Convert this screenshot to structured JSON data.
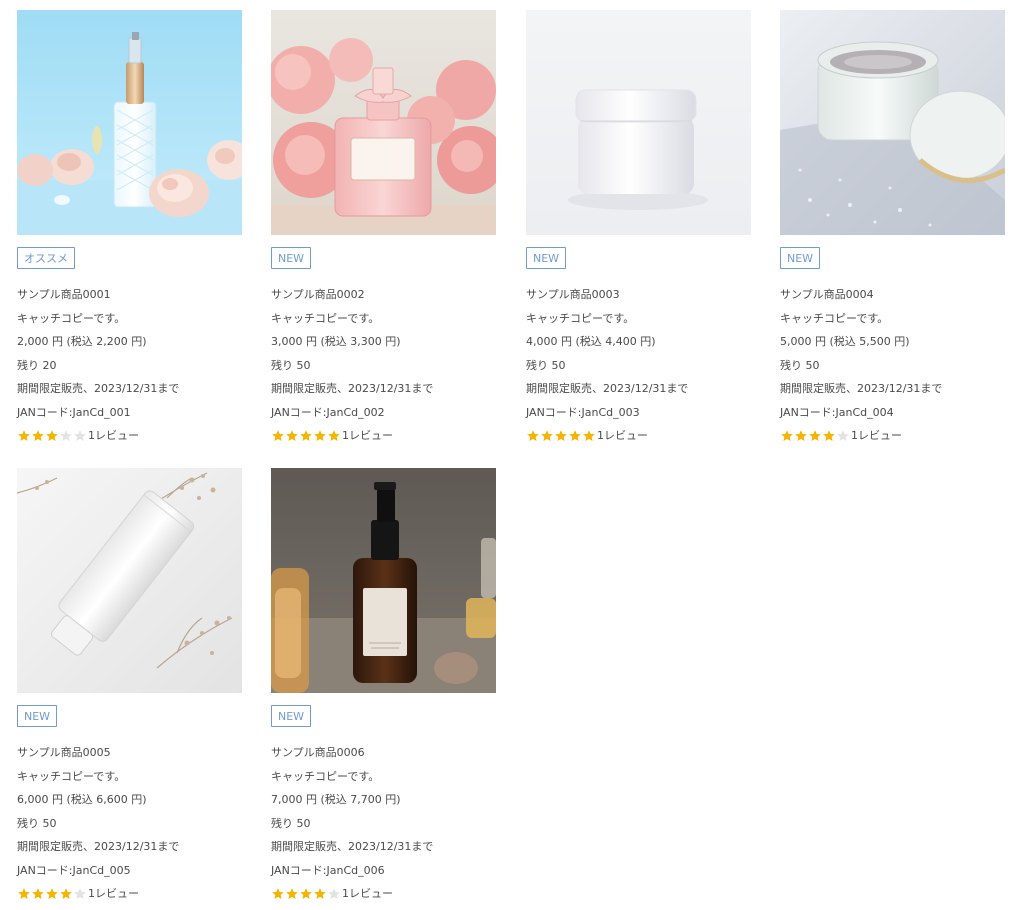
{
  "products": [
    {
      "badge": "オススメ",
      "name": "サンプル商品0001",
      "catch": "キャッチコピーです。",
      "price": "2,000 円 (税込 2,200 円)",
      "stock": "残り 20",
      "limited": "期間限定販売、2023/12/31まで",
      "jan": "JANコード:JanCd_001",
      "rating": 3,
      "reviews": "1レビュー",
      "image": "perfume-spray-bottle-with-roses-on-blue"
    },
    {
      "badge": "NEW",
      "name": "サンプル商品0002",
      "catch": "キャッチコピーです。",
      "price": "3,000 円 (税込 3,300 円)",
      "stock": "残り 50",
      "limited": "期間限定販売、2023/12/31まで",
      "jan": "JANコード:JanCd_002",
      "rating": 5,
      "reviews": "1レビュー",
      "image": "pink-perfume-bottle-with-pink-roses"
    },
    {
      "badge": "NEW",
      "name": "サンプル商品0003",
      "catch": "キャッチコピーです。",
      "price": "4,000 円 (税込 4,400 円)",
      "stock": "残り 50",
      "limited": "期間限定販売、2023/12/31まで",
      "jan": "JANコード:JanCd_003",
      "rating": 5,
      "reviews": "1レビュー",
      "image": "white-cream-jar-on-white"
    },
    {
      "badge": "NEW",
      "name": "サンプル商品0004",
      "catch": "キャッチコピーです。",
      "price": "5,000 円 (税込 5,500 円)",
      "stock": "残り 50",
      "limited": "期間限定販売、2023/12/31まで",
      "jan": "JANコード:JanCd_004",
      "rating": 4,
      "reviews": "1レビュー",
      "image": "open-cream-jar-with-water-drops"
    },
    {
      "badge": "NEW",
      "name": "サンプル商品0005",
      "catch": "キャッチコピーです。",
      "price": "6,000 円 (税込 6,600 円)",
      "stock": "残り 50",
      "limited": "期間限定販売、2023/12/31まで",
      "jan": "JANコード:JanCd_005",
      "rating": 4,
      "reviews": "1レビュー",
      "image": "white-tube-with-dried-flowers"
    },
    {
      "badge": "NEW",
      "name": "サンプル商品0006",
      "catch": "キャッチコピーです。",
      "price": "7,000 円 (税込 7,700 円)",
      "stock": "残り 50",
      "limited": "期間限定販売、2023/12/31まで",
      "jan": "JANコード:JanCd_006",
      "rating": 4,
      "reviews": "1レビュー",
      "image": "amber-spray-bottle-on-wooden-table"
    }
  ],
  "colors": {
    "badge_border": "#6f9ad6",
    "star_filled": "#f5b400",
    "star_empty": "#e3e3e3",
    "text": "#4a4a4a"
  }
}
